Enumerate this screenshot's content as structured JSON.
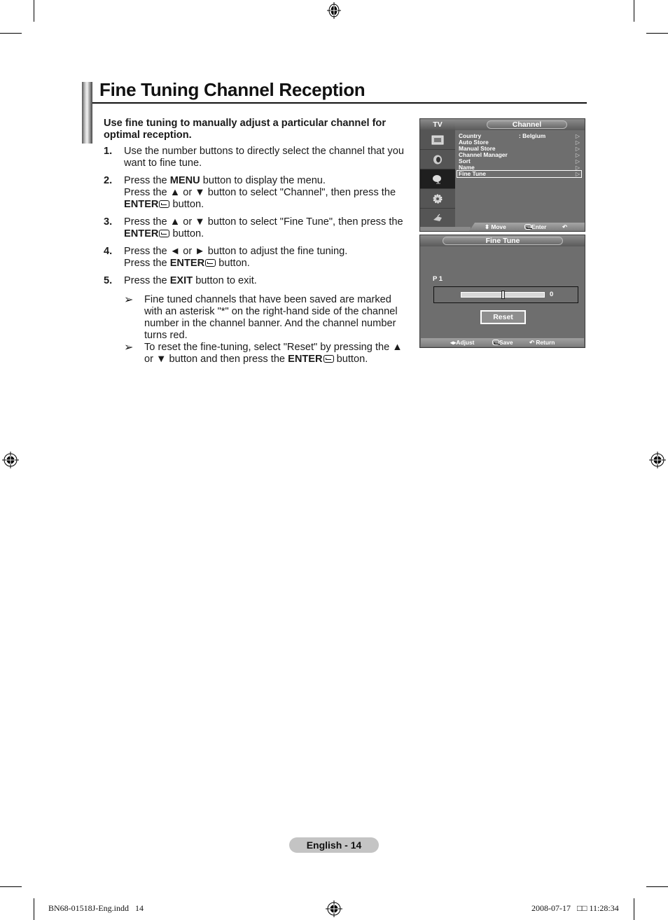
{
  "page": {
    "title": "Fine Tuning Channel Reception",
    "intro": "Use fine tuning to manually adjust a particular channel for optimal reception.",
    "steps": [
      {
        "num": "1.",
        "parts": [
          "Use the number buttons to directly select the channel that you want to fine tune."
        ]
      },
      {
        "num": "2.",
        "line1_pre": "Press the ",
        "line1_bold": "MENU",
        "line1_post": " button to display the menu.",
        "line2_pre": "Press the ▲ or ▼ button to select \"Channel\", then press the ",
        "line2_bold": "ENTER",
        "line2_post": " button."
      },
      {
        "num": "3.",
        "pre": "Press the ▲ or ▼ button to select \"Fine Tune\", then press the ",
        "bold": "ENTER",
        "post": " button."
      },
      {
        "num": "4.",
        "line1": "Press the ◄ or ► button to adjust the fine tuning.",
        "line2_pre": "Press the ",
        "line2_bold": "ENTER",
        "line2_post": " button."
      },
      {
        "num": "5.",
        "pre": "Press the ",
        "bold": "EXIT",
        "post": " button to exit."
      }
    ],
    "notes": [
      {
        "icon": "arrow-note-icon",
        "text": "Fine tuned channels that have been saved are marked with an asterisk \"*\" on the right-hand side of the channel number in the channel banner.  And the channel number turns red."
      },
      {
        "icon": "arrow-note-icon",
        "pre": "To reset the fine-tuning, select \"Reset\" by pressing the ▲ or ▼ button and then press the ",
        "bold": "ENTER",
        "post": " button."
      }
    ],
    "note_arrow": "➢",
    "page_number": "English - 14",
    "slug_left": "BN68-01518J-Eng.indd   14",
    "slug_right": "2008-07-17   □□ 11:28:34"
  },
  "channel_menu": {
    "tab": "TV",
    "header": "Channel",
    "side_icons": [
      "picture-icon",
      "sound-icon",
      "channel-icon",
      "setup-icon",
      "input-icon"
    ],
    "selected_side": 2,
    "items": [
      {
        "label": "Country",
        "value": ": Belgium"
      },
      {
        "label": "Auto Store",
        "value": ""
      },
      {
        "label": "Manual Store",
        "value": ""
      },
      {
        "label": "Channel Manager",
        "value": ""
      },
      {
        "label": "Sort",
        "value": ""
      },
      {
        "label": "Name",
        "value": ""
      },
      {
        "label": "Fine Tune",
        "value": ""
      }
    ],
    "selected_item": 6,
    "arrow": "▷",
    "footer": {
      "move": "⬍ Move",
      "enter": "Enter",
      "return": "↶ Return"
    }
  },
  "fine_tune_menu": {
    "header": "Fine Tune",
    "program": "P 1",
    "value": "0",
    "slider_fraction": 0.5,
    "reset_label": "Reset",
    "footer": {
      "adjust": "◂▸Adjust",
      "save": "Save",
      "return": "↶ Return"
    }
  }
}
